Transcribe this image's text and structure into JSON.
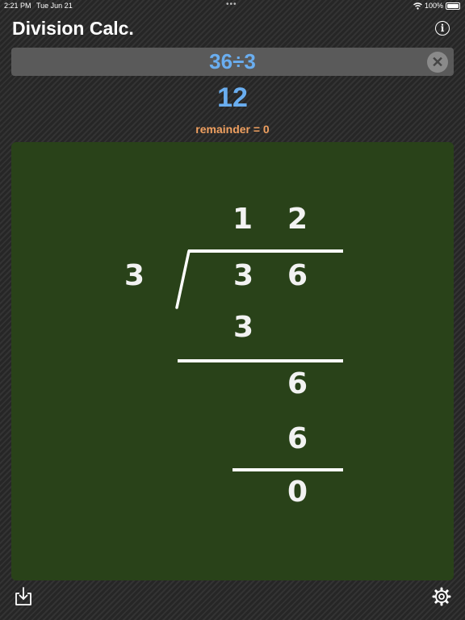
{
  "status": {
    "time": "2:21 PM",
    "date": "Tue Jun 21",
    "battery": "100%"
  },
  "app": {
    "title": "Division Calc."
  },
  "input": {
    "expression": "36÷3",
    "clear_glyph": "✕"
  },
  "result": {
    "quotient": "12",
    "remainder_text": "remainder = 0"
  },
  "board": {
    "quotient_digits": [
      "1",
      "2"
    ],
    "divisor": "3",
    "dividend_digits": [
      "3",
      "6"
    ],
    "step1_product": "3",
    "step1_bringdown": "6",
    "step2_product": "6",
    "final_remainder": "0"
  },
  "icons": {
    "info": "info-icon",
    "clear": "clear-icon",
    "export": "download-icon",
    "settings": "gear-icon"
  },
  "colors": {
    "accent_blue": "#6aaef0",
    "remainder_orange": "#f0a060",
    "chalkboard": "#294219"
  }
}
